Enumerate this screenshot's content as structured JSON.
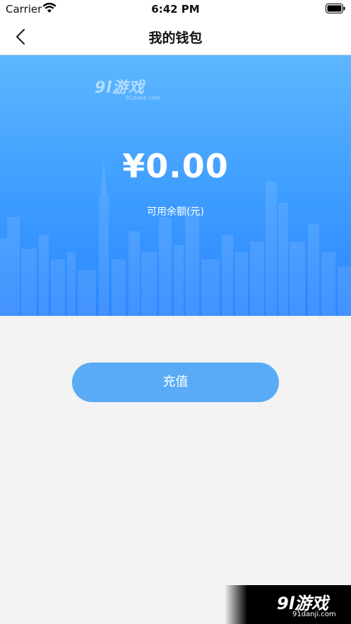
{
  "status_bar": {
    "carrier": "Carrier",
    "time": "6:42 PM",
    "icons": [
      "wifi-icon",
      "battery-icon"
    ]
  },
  "nav": {
    "back_icon": "chevron-left-icon",
    "title": "我的钱包"
  },
  "wallet": {
    "balance": "¥0.00",
    "balance_label": "可用余额(元)",
    "recharge_label": "充值"
  },
  "watermark": {
    "logo_text": "9l游戏",
    "logo_url_text": "91danji.com"
  },
  "colors": {
    "hero_top": "#5db7ff",
    "hero_bottom": "#2d86ff",
    "button": "#5aabf6",
    "page_bg": "#f3f3f3"
  }
}
